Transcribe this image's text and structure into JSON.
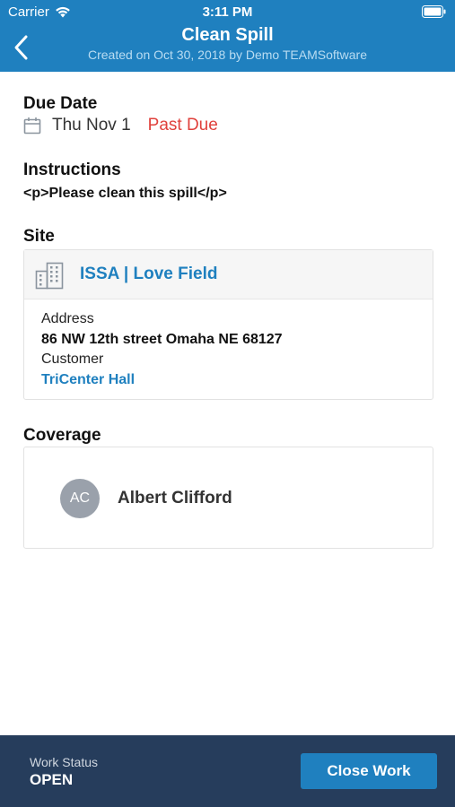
{
  "status_bar": {
    "carrier": "Carrier",
    "time": "3:11 PM"
  },
  "nav": {
    "title": "Clean Spill",
    "subtitle": "Created on Oct 30, 2018 by Demo TEAMSoftware"
  },
  "due_date": {
    "label": "Due Date",
    "date": "Thu Nov 1",
    "status": "Past Due"
  },
  "instructions": {
    "label": "Instructions",
    "text": "<p>Please clean this spill</p>"
  },
  "site": {
    "label": "Site",
    "name": "ISSA | Love Field",
    "address_label": "Address",
    "address_value": "86 NW 12th street Omaha NE 68127",
    "customer_label": "Customer",
    "customer_value": "TriCenter Hall"
  },
  "coverage": {
    "label": "Coverage",
    "initials": "AC",
    "name": "Albert Clifford"
  },
  "footer": {
    "work_status_label": "Work Status",
    "work_status_value": "OPEN",
    "close_button": "Close Work"
  },
  "colors": {
    "header": "#1f80bf",
    "footer": "#263d5c",
    "past_due": "#e0413c",
    "link": "#1f80bf"
  },
  "icons": [
    "wifi-icon",
    "battery-icon",
    "back-chevron-icon",
    "calendar-icon",
    "building-icon"
  ]
}
